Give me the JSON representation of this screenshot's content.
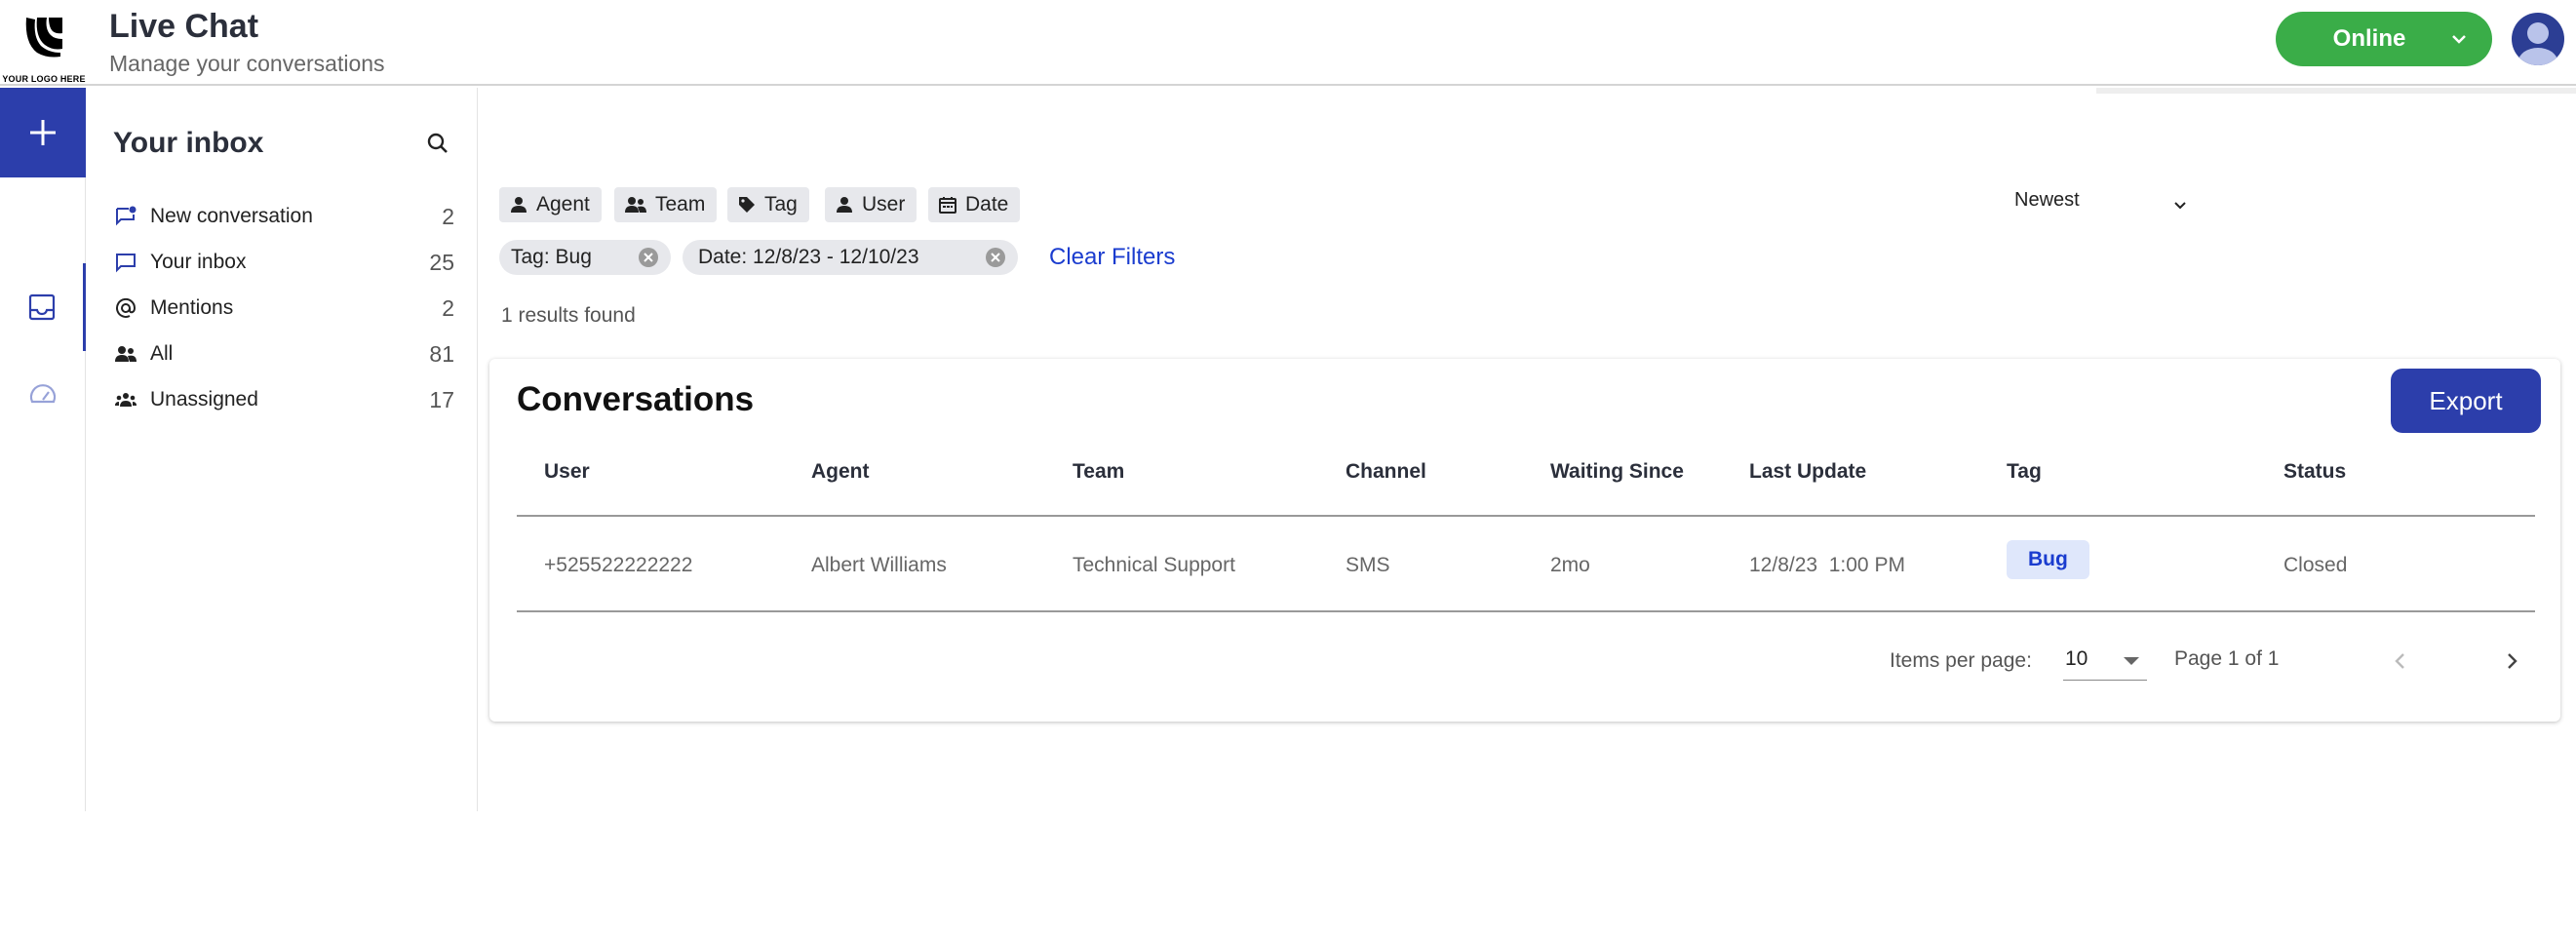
{
  "header": {
    "logo_text": "YOUR LOGO HERE",
    "title": "Live Chat",
    "subtitle": "Manage your conversations",
    "status_label": "Online",
    "status_color": "#3aad48"
  },
  "rail": {
    "items": [
      {
        "icon": "plus-icon"
      },
      {
        "icon": "inbox-icon"
      },
      {
        "icon": "dashboard-gauge-icon"
      }
    ],
    "accent_color": "#2c3eab"
  },
  "sidebar": {
    "title": "Your inbox",
    "items": [
      {
        "label": "New conversation",
        "count": "2",
        "icon": "new-conversation-icon"
      },
      {
        "label": "Your inbox",
        "count": "25",
        "icon": "chat-bubble-icon"
      },
      {
        "label": "Mentions",
        "count": "2",
        "icon": "at-sign-icon"
      },
      {
        "label": "All",
        "count": "81",
        "icon": "people-icon"
      },
      {
        "label": "Unassigned",
        "count": "17",
        "icon": "group-icon"
      }
    ]
  },
  "filters": {
    "chips": [
      {
        "label": "Agent",
        "icon": "person-icon"
      },
      {
        "label": "Team",
        "icon": "team-icon"
      },
      {
        "label": "Tag",
        "icon": "tag-icon"
      },
      {
        "label": "User",
        "icon": "person-icon"
      },
      {
        "label": "Date",
        "icon": "calendar-icon"
      }
    ],
    "active": [
      {
        "label": "Tag: Bug"
      },
      {
        "label": "Date: 12/8/23 - 12/10/23"
      }
    ],
    "clear_label": "Clear Filters",
    "sort_value": "Newest",
    "results_text": "1 results found"
  },
  "conversations": {
    "title": "Conversations",
    "export_label": "Export",
    "columns": [
      "User",
      "Agent",
      "Team",
      "Channel",
      "Waiting Since",
      "Last Update",
      "Tag",
      "Status"
    ],
    "rows": [
      {
        "user": "+525522222222",
        "agent": "Albert Williams",
        "team": "Technical Support",
        "channel": "SMS",
        "waiting_since": "2mo",
        "last_update": "12/8/23  1:00 PM",
        "tag": "Bug",
        "status": "Closed"
      }
    ],
    "pagination": {
      "items_per_page_label": "Items per page:",
      "items_per_page": "10",
      "page_info": "Page 1 of 1"
    }
  }
}
